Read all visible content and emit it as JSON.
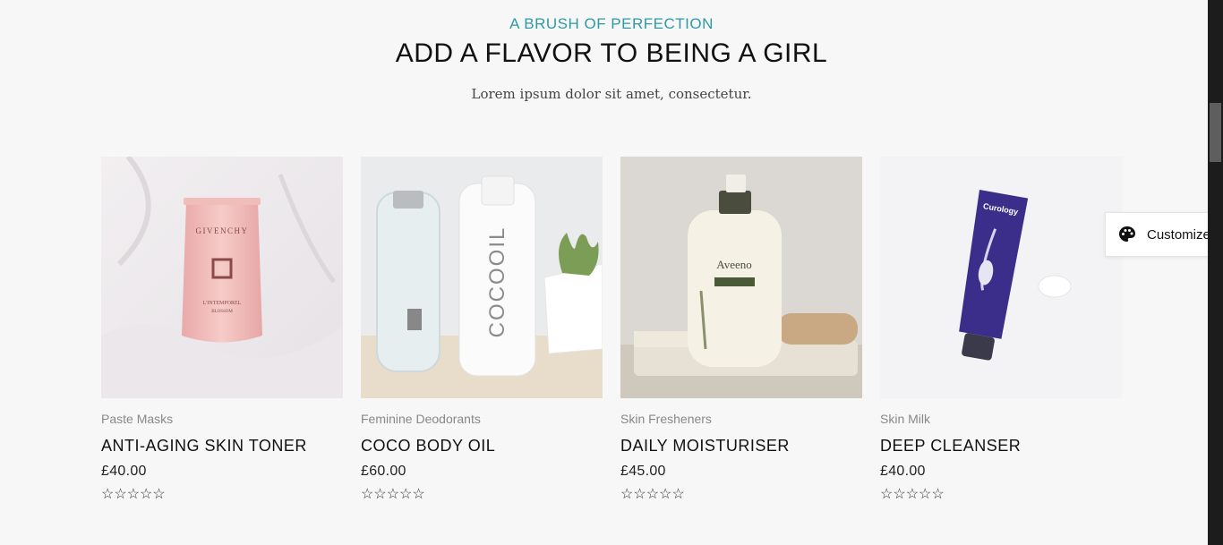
{
  "section": {
    "eyebrow": "A BRUSH OF PERFECTION",
    "heading": "ADD A FLAVOR TO BEING A GIRL",
    "subtitle": "Lorem ipsum dolor sit amet, consectetur."
  },
  "products": [
    {
      "category": "Paste Masks",
      "title": "ANTI-AGING SKIN TONER",
      "price": "£40.00",
      "rating": "☆☆☆☆☆",
      "image_text": "GIVENCHY"
    },
    {
      "category": "Feminine Deodorants",
      "title": "COCO BODY OIL",
      "price": "£60.00",
      "rating": "☆☆☆☆☆",
      "image_text": "COCOOIL"
    },
    {
      "category": "Skin Fresheners",
      "title": "DAILY MOISTURISER",
      "price": "£45.00",
      "rating": "☆☆☆☆☆",
      "image_text": "Aveeno"
    },
    {
      "category": "Skin Milk",
      "title": "DEEP CLEANSER",
      "price": "£40.00",
      "rating": "☆☆☆☆☆",
      "image_text": "Curology"
    }
  ],
  "customize": {
    "label": "Customize",
    "icon": "palette-icon"
  },
  "colors": {
    "accent": "#2f9aa7",
    "background": "#f7f7f7"
  }
}
